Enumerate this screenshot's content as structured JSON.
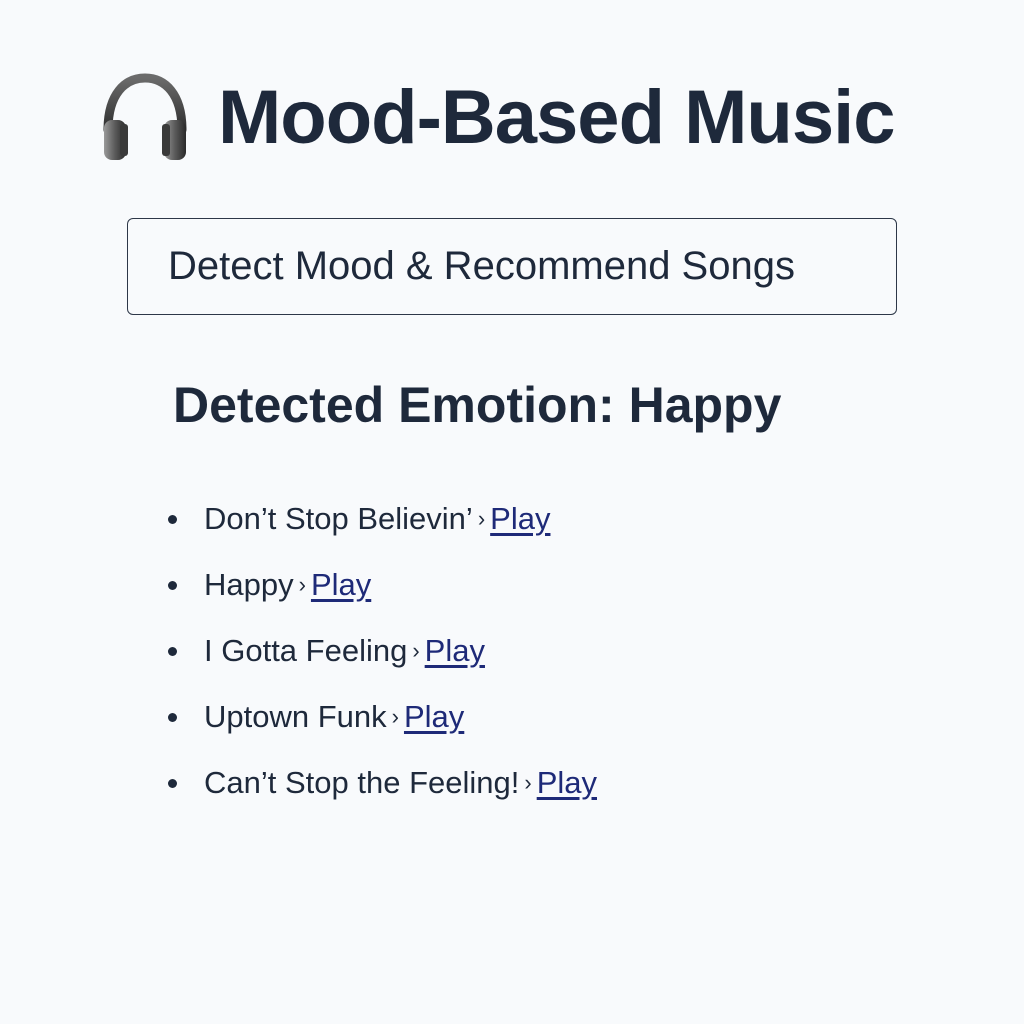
{
  "header": {
    "icon": "headphones-icon",
    "title": "Mood-Based Music"
  },
  "detect_button": {
    "label": "Detect Mood & Recommend Songs"
  },
  "result": {
    "heading": "Detected Emotion: Happy"
  },
  "songs": [
    {
      "title": "Don’t Stop Believin’",
      "separator": "›",
      "link": "Play"
    },
    {
      "title": "Happy",
      "separator": "›",
      "link": "Play"
    },
    {
      "title": "I Gotta Feeling",
      "separator": "›",
      "link": "Play"
    },
    {
      "title": "Uptown Funk",
      "separator": "›",
      "link": "Play"
    },
    {
      "title": "Can’t Stop the Feeling!",
      "separator": "›",
      "link": "Play"
    }
  ],
  "colors": {
    "background": "#f8fafc",
    "text": "#1e293b",
    "link": "#1e2a78"
  }
}
